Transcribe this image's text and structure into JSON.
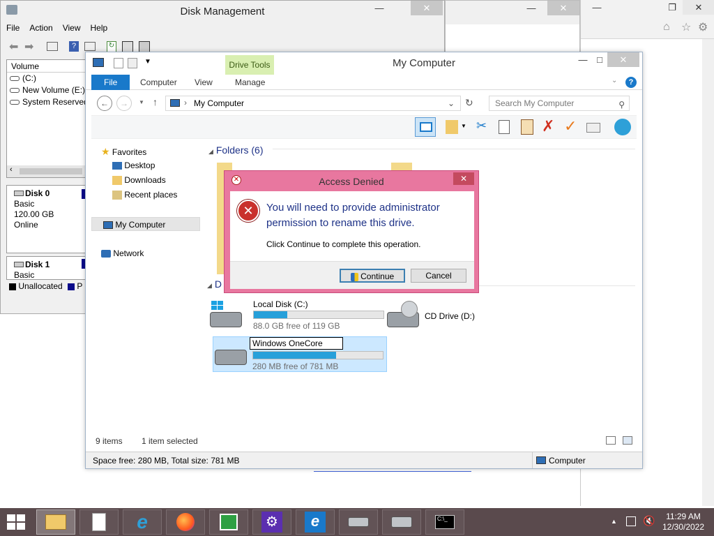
{
  "disk_mgmt": {
    "title": "Disk Management",
    "menu": [
      "File",
      "Action",
      "View",
      "Help"
    ],
    "volume_header": "Volume",
    "volumes": [
      "(C:)",
      "New Volume (E:)",
      "System Reserved"
    ],
    "disk0": {
      "name": "Disk 0",
      "type": "Basic",
      "size": "120.00 GB",
      "status": "Online"
    },
    "disk1": {
      "name": "Disk 1",
      "type": "Basic",
      "legend_unallocated": "Unallocated",
      "legend_p": "P"
    }
  },
  "explorer": {
    "title": "My Computer",
    "context_tab_group": "Drive Tools",
    "tabs": [
      "File",
      "Computer",
      "View",
      "Manage"
    ],
    "address": "My Computer",
    "search_placeholder": "Search My Computer",
    "nav": {
      "favorites": "Favorites",
      "desktop": "Desktop",
      "downloads": "Downloads",
      "recent": "Recent places",
      "my_computer": "My Computer",
      "network": "Network"
    },
    "folders_header": "Folders (6)",
    "devices_header_partial": "D",
    "drives": [
      {
        "name": "Local Disk (C:)",
        "free": "88.0 GB free of 119 GB",
        "fill": 0.26
      },
      {
        "name": "CD Drive (D:)"
      },
      {
        "name": "Windows OneCore",
        "free": "280 MB free of 781 MB",
        "fill": 0.64
      }
    ],
    "status_items": "9 items",
    "status_selected": "1 item selected",
    "info_space": "Space free: 280 MB, Total size: 781 MB",
    "info_location": "Computer"
  },
  "dialog": {
    "title": "Access Denied",
    "message": "You will need to provide administrator permission to rename this drive.",
    "sub": "Click Continue to complete this operation.",
    "continue_label": "Continue",
    "cancel_label": "Cancel"
  },
  "taskbar": {
    "time": "11:29 AM",
    "date": "12/30/2022"
  },
  "colors": {
    "dialog_frame": "#e8779f",
    "accent_blue": "#1979ca",
    "drive_bar": "#26a0da",
    "taskbar": "#5a4a4d"
  }
}
